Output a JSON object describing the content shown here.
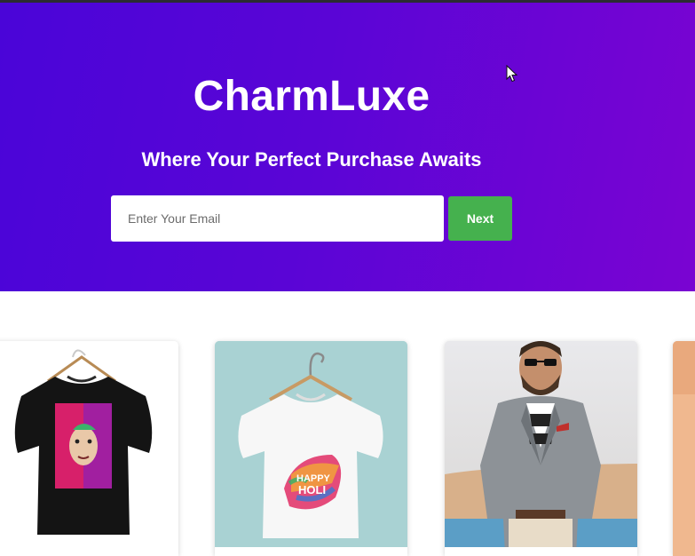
{
  "hero": {
    "brand": "CharmLuxe",
    "tagline": "Where Your Perfect Purchase Awaits",
    "email_placeholder": "Enter Your Email",
    "next_label": "Next"
  },
  "colors": {
    "hero_gradient_start": "#4a05d8",
    "hero_gradient_end": "#7a04d2",
    "next_button": "#45b14e"
  },
  "products": [
    {
      "icon": "black-tshirt-image"
    },
    {
      "icon": "white-tshirt-happy-holi-image"
    },
    {
      "icon": "man-in-blazer-image"
    },
    {
      "icon": "partial-product-image"
    }
  ]
}
